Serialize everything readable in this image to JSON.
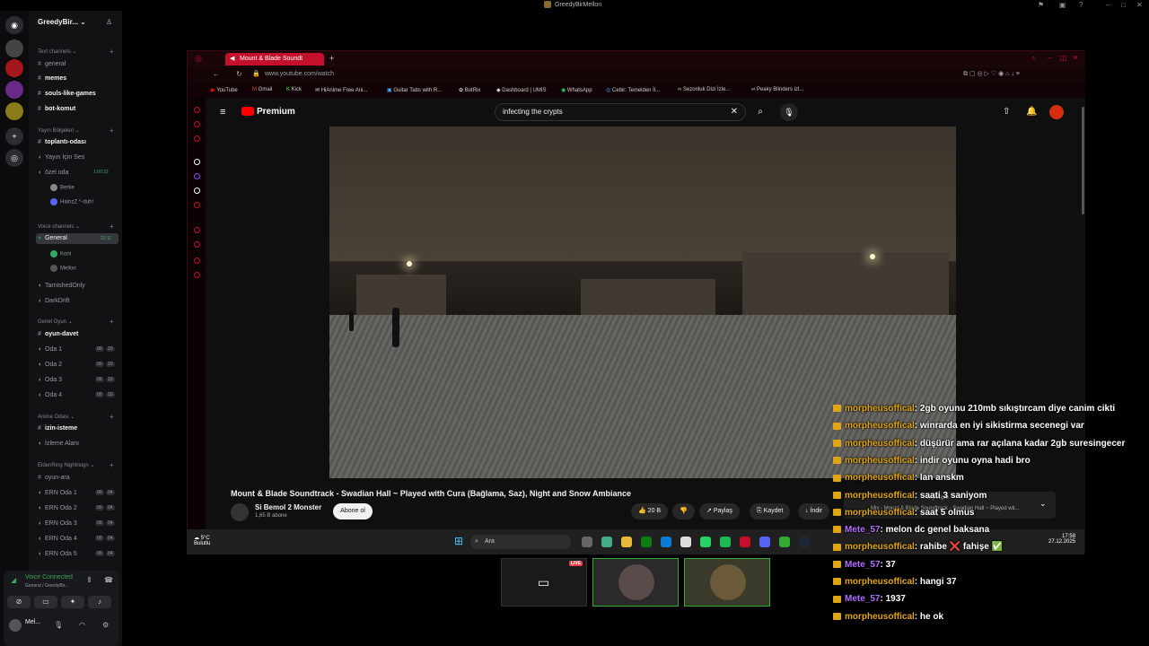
{
  "window": {
    "title": "GreedyBirMellon"
  },
  "discord": {
    "guild_name": "GreedyBir...",
    "categories": {
      "text": "Text channels",
      "yayin": "Yayın Bölgeleri",
      "voice": "Voice channels",
      "genel_oyun": "Genel Oyun",
      "anime": "Anime Odası",
      "eldenring": "EldenRing Nightreign"
    },
    "text_channels": [
      "general",
      "memes",
      "souls-like-games",
      "bot-komut"
    ],
    "yayin_channels": [
      "toplantı-odası",
      "Yayın İçin Ses",
      "özel oda"
    ],
    "ozel_oda_timer": "1:00:32",
    "ozel_oda_users": [
      "Berke",
      "HainzZ ^-duh!"
    ],
    "voice_general": "General",
    "voice_general_timer": "22:11",
    "voice_general_users": [
      "Korii",
      "Mellon"
    ],
    "live_label": "LIVE",
    "voice_channels_other": [
      "TarnishedOnly",
      "DarkDrift"
    ],
    "genel_oyun_channels": [
      "oyun-davet",
      "Oda 1",
      "Oda 2",
      "Oda 3",
      "Oda 4"
    ],
    "anime_channels": [
      "izin-isteme",
      "İzleme Alanı"
    ],
    "eldenring_channels": [
      "oyun-ara",
      "ERN Oda 1",
      "ERN Oda 2",
      "ERN Oda 3",
      "ERN Oda 4",
      "ERN Oda 5"
    ],
    "room_badge_a": "00",
    "room_badge_b": "10",
    "ern_badge_b": "04",
    "voice_connected": "Voice Connected",
    "voice_sub": "General / GreedyBir...",
    "me_name": "Mel..."
  },
  "browser": {
    "tab_title": "Mount & Blade Soundt",
    "url": "www.youtube.com/watch",
    "bookmarks": [
      "YouTube",
      "Gmail",
      "Kick",
      "HiAnime Free Ani...",
      "Guitar Tabs with R...",
      "BotRix",
      "Dashboard | UMIS",
      "WhatsApp",
      "Cebir: Temelden İl...",
      "Sezonluk Dizi İzle...",
      "Peaky Blinders izl..."
    ]
  },
  "youtube": {
    "logo": "Premium",
    "search_value": "infecting the crypts",
    "video_title": "Mount & Blade Soundtrack - Swadian Hall ~ Played with Cura (Bağlama, Saz), Night and Snow Ambiance",
    "channel_name": "Si Bemol 2 Monster",
    "channel_subs": "1,65 B abone",
    "subscribe_label": "Abone ol",
    "like_count": "20 B",
    "share_label": "Paylaş",
    "save_label": "Kaydet",
    "download_label": "İndir",
    "mix_line1": "Mix - Mount & Blade Soundtrack - Swadian Hall ~ Played wit...",
    "mix_line2": "...ic people"
  },
  "taskbar": {
    "weather_temp": "5°C",
    "weather_label": "Bulutlu",
    "search_label": "Ara",
    "time": "17:58",
    "date": "27.12.2025"
  },
  "chat": [
    {
      "user": "morpheusoffical",
      "text": ": 2gb oyunu 210mb sıkıştırcam diye canim cikti"
    },
    {
      "user": "morpheusoffical",
      "text": ": winrarda en iyi sikistirma secenegi var"
    },
    {
      "user": "morpheusoffical",
      "text": ": düşürür ama rar açılana kadar 2gb suresingecer"
    },
    {
      "user": "morpheusoffical",
      "text": ": indir oyunu oyna hadi bro"
    },
    {
      "user": "morpheusoffical",
      "text": ": lan anskm"
    },
    {
      "user": "morpheusoffical",
      "text": ": saati 3 saniyom"
    },
    {
      "user": "morpheusoffical",
      "text": ": saat 5 olmus"
    },
    {
      "user": "Mete_57",
      "text": ": melon dc genel baksana"
    },
    {
      "user": "morpheusoffical",
      "text": ": rahibe ❌ fahişe ✅"
    },
    {
      "user": "Mete_57",
      "text": ": 37"
    },
    {
      "user": "morpheusoffical",
      "text": ": hangi 37"
    },
    {
      "user": "Mete_57",
      "text": ": 1937"
    },
    {
      "user": "morpheusoffical",
      "text": ": he ok"
    }
  ],
  "colors": {
    "accent_red": "#c4102b",
    "discord_green": "#3ba55c",
    "chat_gold": "#e0a514",
    "chat_purple": "#b06cff"
  }
}
